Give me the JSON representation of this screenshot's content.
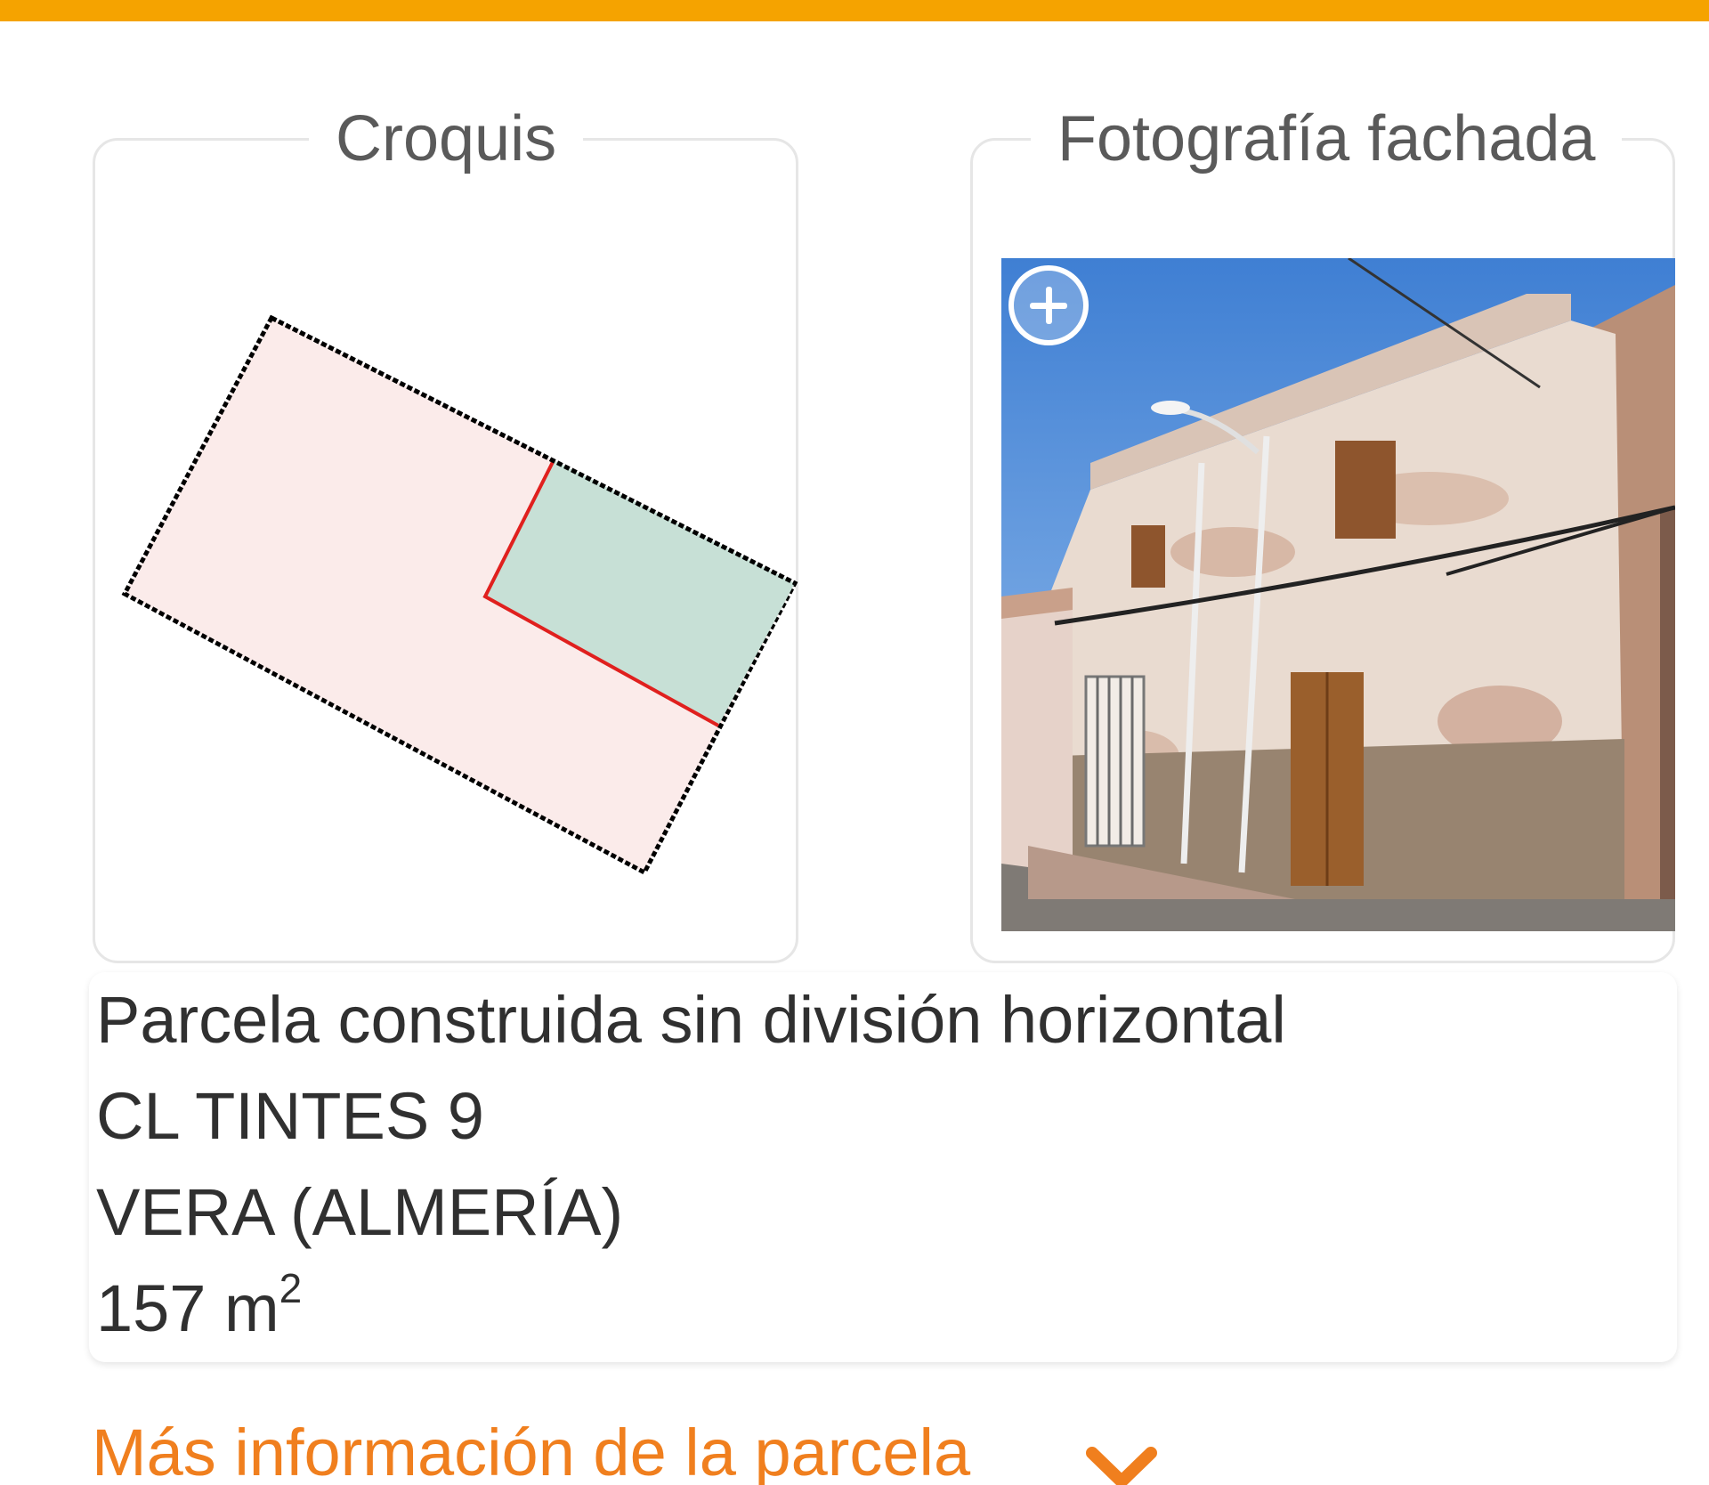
{
  "accent_color": "#f5a300",
  "link_color": "#f07f1e",
  "sketch_panel": {
    "title": "Croquis",
    "parcel_fill": "#fbebea",
    "building_fill": "#c7e0d6",
    "outline_color": "#000000",
    "building_edge_color": "#e0201e"
  },
  "photo_panel": {
    "title": "Fotografía fachada",
    "zoom_icon": "zoom-in-icon"
  },
  "parcel": {
    "type": "Parcela construida sin división horizontal",
    "address": "CL TINTES 9",
    "municipality": "VERA (ALMERÍA)",
    "area_value": "157 m",
    "area_unit_exp": "2"
  },
  "more_info": {
    "label": "Más información de la parcela",
    "icon": "chevron-down-icon"
  }
}
